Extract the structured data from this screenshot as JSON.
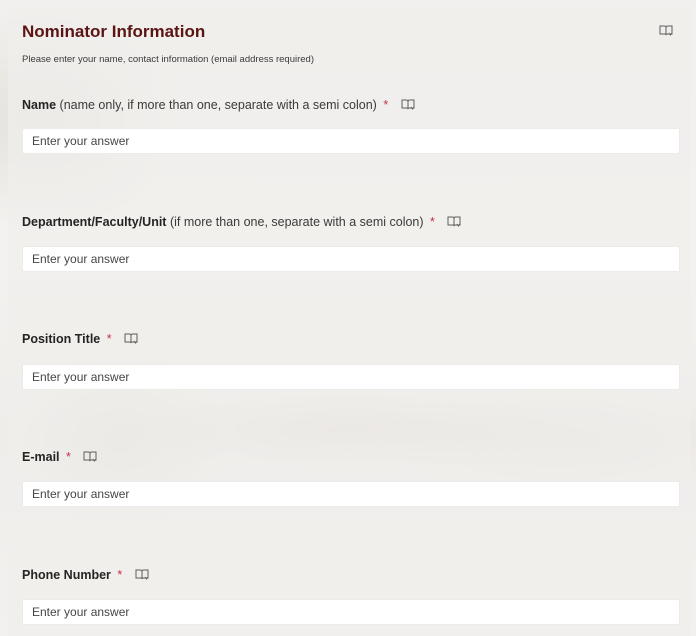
{
  "section": {
    "title": "Nominator Information",
    "description": "Please enter your name, contact information (email address required)"
  },
  "icons": {
    "reader": "immersive-reader-icon"
  },
  "colors": {
    "title": "#5a1414",
    "required": "#c4314b",
    "background": "#f5f3f1"
  },
  "questions": [
    {
      "title": "Name",
      "hint": "(name only, if more than one, separate with a semi colon)",
      "required_mark": "*",
      "placeholder": "Enter your answer"
    },
    {
      "title": "Department/Faculty/Unit",
      "hint": "(if more than one, separate with a semi colon)",
      "required_mark": "*",
      "placeholder": "Enter your answer"
    },
    {
      "title": "Position Title",
      "hint": "",
      "required_mark": "*",
      "placeholder": "Enter your answer"
    },
    {
      "title": "E-mail",
      "hint": "",
      "required_mark": "*",
      "placeholder": "Enter your answer"
    },
    {
      "title": "Phone Number",
      "hint": "",
      "required_mark": "*",
      "placeholder": "Enter your answer"
    }
  ]
}
